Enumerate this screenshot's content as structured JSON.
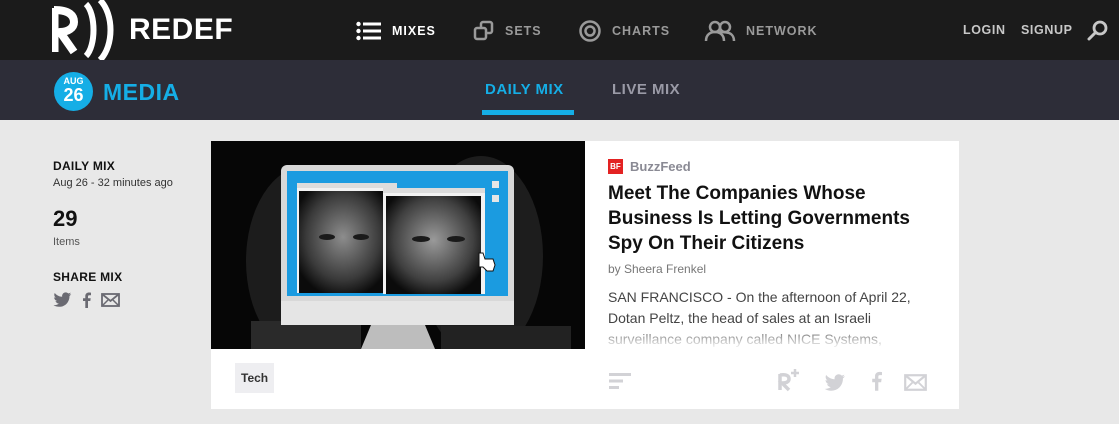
{
  "header": {
    "brand": "REDEF",
    "nav": [
      {
        "label": "MIXES",
        "icon": "list-icon"
      },
      {
        "label": "SETS",
        "icon": "sets-icon"
      },
      {
        "label": "CHARTS",
        "icon": "charts-icon"
      },
      {
        "label": "NETWORK",
        "icon": "network-icon"
      }
    ],
    "login": "LOGIN",
    "signup": "SIGNUP"
  },
  "subheader": {
    "badge_month": "AUG",
    "badge_day": "26",
    "section": "MEDIA",
    "tabs": [
      "DAILY MIX",
      "LIVE MIX"
    ],
    "active_tab": "DAILY MIX"
  },
  "sidebar": {
    "mix_label": "DAILY MIX",
    "mix_time": "Aug 26 - 32 minutes ago",
    "count": "29",
    "count_label": "Items",
    "share_label": "SHARE MIX",
    "share_icons": [
      "twitter-icon",
      "facebook-icon",
      "email-icon"
    ]
  },
  "article": {
    "source_badge": "BF",
    "source": "BuzzFeed",
    "headline": "Meet The Companies Whose Business Is Letting Governments Spy On Their Citizens",
    "byline": "by Sheera Frenkel",
    "excerpt": "SAN FRANCISCO - On the afternoon of April 22, Dotan Peltz, the head of sales at an Israeli surveillance company called NICE Systems,",
    "tag": "Tech",
    "actions": [
      "menu-icon",
      "redef-share-icon",
      "twitter-icon",
      "facebook-icon",
      "email-icon"
    ]
  },
  "colors": {
    "topbar": "#1b1b1b",
    "subbar": "#2d2d38",
    "accent": "#15aee6",
    "buzzfeed_red": "#e32222",
    "page_bg": "#e8e8e8"
  }
}
